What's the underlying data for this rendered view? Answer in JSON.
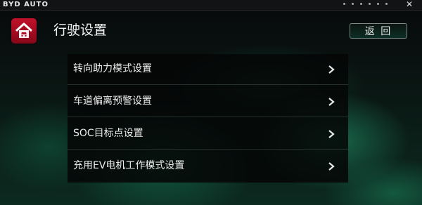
{
  "status_bar": {
    "brand": "BYD AUTO"
  },
  "header": {
    "title": "行驶设置",
    "back_button": "返 回",
    "icon": "car-settings-icon"
  },
  "menu": {
    "items": [
      {
        "label": "转向助力模式设置",
        "icon": "chevron-right-icon"
      },
      {
        "label": "车道偏离预警设置",
        "icon": "chevron-right-icon"
      },
      {
        "label": "SOC目标点设置",
        "icon": "chevron-right-icon"
      },
      {
        "label": "充用EV电机工作模式设置",
        "icon": "chevron-right-icon"
      }
    ]
  },
  "colors": {
    "accent_red": "#b30e24",
    "background_green": "#1a6e50"
  }
}
